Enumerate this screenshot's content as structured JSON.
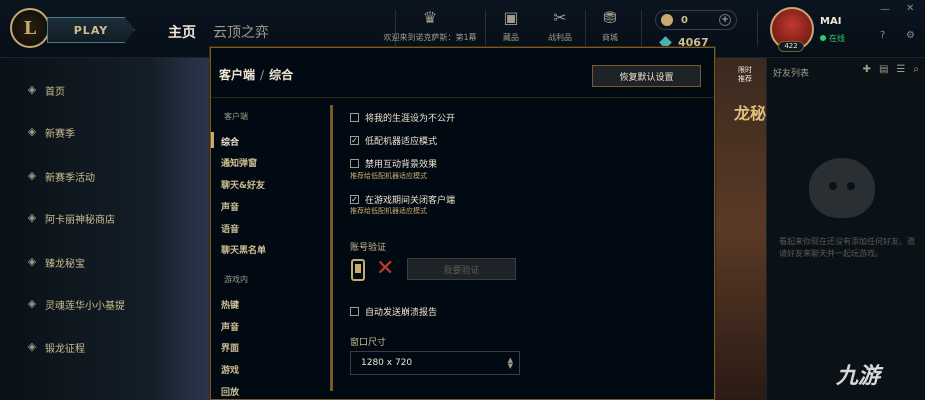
{
  "topbar": {
    "logo": "L",
    "play": "PLAY",
    "nav_home": "主页",
    "nav_tft": "云顶之弈",
    "nav_items": [
      {
        "icon": "crest-icon",
        "label": "欢迎来到诺克萨斯：第1幕"
      },
      {
        "icon": "shop-icon",
        "label": "藏品"
      },
      {
        "icon": "loot-icon",
        "label": "战利品"
      },
      {
        "icon": "store-icon",
        "label": "商城"
      }
    ],
    "rp": "0",
    "be": "4067",
    "username": "MAI",
    "level": "422",
    "status": "在线"
  },
  "sidebar": {
    "items": [
      "首页",
      "新赛季",
      "新赛季活动",
      "阿卡丽神秘商店",
      "臻龙秘宝",
      "灵魂莲华小小基提",
      "锻龙征程"
    ]
  },
  "art": {
    "banner": "龙秘宝",
    "tag": "限时推荐"
  },
  "friends": {
    "title": "好友列表",
    "empty": "看起来你现在还没有添加任何好友。邀请好友来聊天并一起玩游戏。"
  },
  "watermark": "九游",
  "modal": {
    "crumb_parent": "客户端",
    "crumb_sep": "/",
    "crumb_current": "综合",
    "restore": "恢复默认设置",
    "menu": {
      "client_cat": "客户端",
      "client_items": [
        "综合",
        "通知弹窗",
        "聊天&好友",
        "声音",
        "语音",
        "聊天黑名单"
      ],
      "ingame_cat": "游戏内",
      "ingame_items": [
        "热键",
        "声音",
        "界面",
        "游戏",
        "回放"
      ]
    },
    "options": [
      {
        "label": "将我的生涯设为不公开",
        "checked": false
      },
      {
        "label": "低配机器适应模式",
        "checked": true
      },
      {
        "label": "禁用互动背景效果",
        "checked": false,
        "rec": "推荐给低配机器适应模式"
      },
      {
        "label": "在游戏期间关闭客户端",
        "checked": true,
        "rec": "推荐给低配机器适应模式"
      }
    ],
    "account_label": "账号验证",
    "verify_btn": "我要验证",
    "crash_report": {
      "label": "自动发送崩溃报告",
      "checked": false
    },
    "window_label": "窗口尺寸",
    "window_size": "1280 x 720"
  }
}
